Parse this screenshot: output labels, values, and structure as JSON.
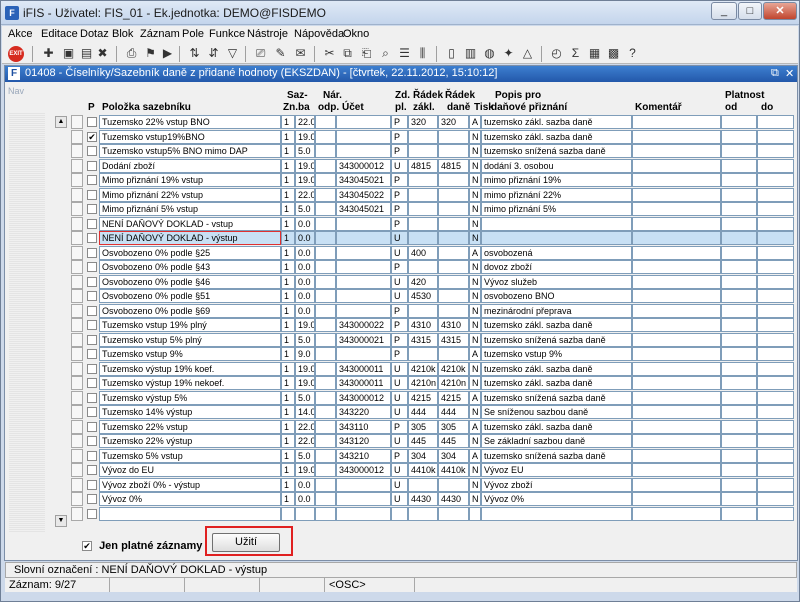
{
  "window": {
    "title": "iFIS - Uživatel: FIS_01 - Ek.jednotka: DEMO@FISDEMO",
    "logo_text": "iFIS"
  },
  "menu": [
    "Akce",
    "Editace",
    "Dotaz",
    "Blok",
    "Záznam",
    "Pole",
    "Funkce",
    "Nástroje",
    "Nápověda",
    "Okno"
  ],
  "toolbar": {
    "exit_label": "EXIT"
  },
  "form": {
    "title": "01408 - Číselníky/Sazebník daně z přidané hodnoty (EKSZDAN) - [čtvrtek, 22.11.2012, 15:10:12]",
    "nav_label": "Nav"
  },
  "columns": {
    "p": "P",
    "name": "Položka sazebníku",
    "zn": [
      "Saz-",
      "Zn.ba"
    ],
    "nar": [
      "Nár.",
      "odp."
    ],
    "ucet": "Účet",
    "zd": [
      "Zd.",
      "pl."
    ],
    "rz": [
      "Řádek",
      "zákl."
    ],
    "rd": [
      "Řádek",
      "daně"
    ],
    "tisk": "Tisk",
    "popis": [
      "Popis pro",
      "daňové přiznání"
    ],
    "komentar": "Komentář",
    "platnost": "Platnost",
    "od": "od",
    "do": "do"
  },
  "rows": [
    {
      "checked": false,
      "name": "Tuzemsko  22% vstup BNO",
      "zn": "1",
      "sazba": "22.0",
      "ucet": "",
      "zd": "P",
      "rz": "320",
      "rd": "320",
      "tisk": "A",
      "popis": "tuzemsko zákl. sazba daně"
    },
    {
      "checked": true,
      "name": "Tuzemsko vstup19%BNO",
      "zn": "1",
      "sazba": "19.0",
      "ucet": "",
      "zd": "P",
      "rz": "",
      "rd": "",
      "tisk": "N",
      "popis": "tuzemsko zákl. sazba daně"
    },
    {
      "checked": false,
      "name": "Tuzemsko vstup5% BNO mimo DAP",
      "zn": "1",
      "sazba": "5.0",
      "ucet": "",
      "zd": "P",
      "rz": "",
      "rd": "",
      "tisk": "N",
      "popis": "tuzemsko snížená sazba daně"
    },
    {
      "checked": false,
      "name": "Dodání zboží",
      "zn": "1",
      "sazba": "19.0",
      "ucet": "343000012",
      "zd": "U",
      "rz": "4815",
      "rd": "4815",
      "tisk": "N",
      "popis": "dodání 3. osobou"
    },
    {
      "checked": false,
      "name": "Mimo přiznání  19% vstup",
      "zn": "1",
      "sazba": "19.0",
      "ucet": "343045021",
      "zd": "P",
      "rz": "",
      "rd": "",
      "tisk": "N",
      "popis": "mimo přiznání 19%"
    },
    {
      "checked": false,
      "name": "Mimo přiznání  22% vstup",
      "zn": "1",
      "sazba": "22.0",
      "ucet": "343045022",
      "zd": "P",
      "rz": "",
      "rd": "",
      "tisk": "N",
      "popis": "mimo přiznání 22%"
    },
    {
      "checked": false,
      "name": "Mimo přiznání  5% vstup",
      "zn": "1",
      "sazba": "5.0",
      "ucet": "343045021",
      "zd": "P",
      "rz": "",
      "rd": "",
      "tisk": "N",
      "popis": "mimo přiznání 5%"
    },
    {
      "checked": false,
      "name": "NENÍ DAŇOVÝ DOKLAD - vstup",
      "zn": "1",
      "sazba": "0.0",
      "ucet": "",
      "zd": "P",
      "rz": "",
      "rd": "",
      "tisk": "N",
      "popis": ""
    },
    {
      "checked": false,
      "name": "NENÍ DAŇOVÝ DOKLAD - výstup",
      "zn": "1",
      "sazba": "0.0",
      "ucet": "",
      "zd": "U",
      "rz": "",
      "rd": "",
      "tisk": "N",
      "popis": "",
      "selected": true
    },
    {
      "checked": false,
      "name": "Osvobozeno 0% podle §25",
      "zn": "1",
      "sazba": "0.0",
      "ucet": "",
      "zd": "U",
      "rz": "400",
      "rd": "",
      "tisk": "A",
      "popis": "osvobozená"
    },
    {
      "checked": false,
      "name": "Osvobozeno 0% podle §43",
      "zn": "1",
      "sazba": "0.0",
      "ucet": "",
      "zd": "P",
      "rz": "",
      "rd": "",
      "tisk": "N",
      "popis": "dovoz zboží"
    },
    {
      "checked": false,
      "name": "Osvobozeno 0% podle §46",
      "zn": "1",
      "sazba": "0.0",
      "ucet": "",
      "zd": "U",
      "rz": "420",
      "rd": "",
      "tisk": "N",
      "popis": "Vývoz služeb"
    },
    {
      "checked": false,
      "name": "Osvobozeno 0% podle §51",
      "zn": "1",
      "sazba": "0.0",
      "ucet": "",
      "zd": "U",
      "rz": "4530",
      "rd": "",
      "tisk": "N",
      "popis": "osvobozeno BNO"
    },
    {
      "checked": false,
      "name": "Osvobozeno 0% podle §69",
      "zn": "1",
      "sazba": "0.0",
      "ucet": "",
      "zd": "P",
      "rz": "",
      "rd": "",
      "tisk": "N",
      "popis": "mezinárodní přeprava"
    },
    {
      "checked": false,
      "name": "Tuzemsko vstup 19% plný",
      "zn": "1",
      "sazba": "19.0",
      "ucet": "343000022",
      "zd": "P",
      "rz": "4310",
      "rd": "4310",
      "tisk": "N",
      "popis": "tuzemsko zákl. sazba daně"
    },
    {
      "checked": false,
      "name": "Tuzemsko vstup 5% plný",
      "zn": "1",
      "sazba": "5.0",
      "ucet": "343000021",
      "zd": "P",
      "rz": "4315",
      "rd": "4315",
      "tisk": "N",
      "popis": "tuzemsko snížená sazba daně"
    },
    {
      "checked": false,
      "name": "Tuzemsko vstup 9%",
      "zn": "1",
      "sazba": "9.0",
      "ucet": "",
      "zd": "P",
      "rz": "",
      "rd": "",
      "tisk": "A",
      "popis": "tuzemsko vstup 9%"
    },
    {
      "checked": false,
      "name": "Tuzemsko výstup 19% koef.",
      "zn": "1",
      "sazba": "19.0",
      "ucet": "343000011",
      "zd": "U",
      "rz": "4210k",
      "rd": "4210k",
      "tisk": "N",
      "popis": "tuzemsko zákl. sazba daně"
    },
    {
      "checked": false,
      "name": "Tuzemsko výstup 19% nekoef.",
      "zn": "1",
      "sazba": "19.0",
      "ucet": "343000011",
      "zd": "U",
      "rz": "4210n",
      "rd": "4210n",
      "tisk": "N",
      "popis": "tuzemsko zákl. sazba daně"
    },
    {
      "checked": false,
      "name": "Tuzemsko výstup 5%",
      "zn": "1",
      "sazba": "5.0",
      "ucet": "343000012",
      "zd": "U",
      "rz": "4215",
      "rd": "4215",
      "tisk": "A",
      "popis": "tuzemsko snížená sazba daně"
    },
    {
      "checked": false,
      "name": "Tuzemsko 14% výstup",
      "zn": "1",
      "sazba": "14.0",
      "ucet": "343220",
      "zd": "U",
      "rz": "444",
      "rd": "444",
      "tisk": "N",
      "popis": "Se sníženou sazbou daně"
    },
    {
      "checked": false,
      "name": "Tuzemsko 22% vstup",
      "zn": "1",
      "sazba": "22.0",
      "ucet": "343110",
      "zd": "P",
      "rz": "305",
      "rd": "305",
      "tisk": "A",
      "popis": "tuzemsko zákl. sazba daně"
    },
    {
      "checked": false,
      "name": "Tuzemsko 22% výstup",
      "zn": "1",
      "sazba": "22.0",
      "ucet": "343120",
      "zd": "U",
      "rz": "445",
      "rd": "445",
      "tisk": "N",
      "popis": "Se základní sazbou daně"
    },
    {
      "checked": false,
      "name": "Tuzemsko 5% vstup",
      "zn": "1",
      "sazba": "5.0",
      "ucet": "343210",
      "zd": "P",
      "rz": "304",
      "rd": "304",
      "tisk": "A",
      "popis": "tuzemsko snížená sazba daně"
    },
    {
      "checked": false,
      "name": "Vývoz do EU",
      "zn": "1",
      "sazba": "19.0",
      "ucet": "343000012",
      "zd": "U",
      "rz": "4410k",
      "rd": "4410k",
      "tisk": "N",
      "popis": "Vývoz EU"
    },
    {
      "checked": false,
      "name": "Vývoz zboží 0% - výstup",
      "zn": "1",
      "sazba": "0.0",
      "ucet": "",
      "zd": "U",
      "rz": "",
      "rd": "",
      "tisk": "N",
      "popis": "   Vývoz zboží"
    },
    {
      "checked": false,
      "name": "Vývoz 0%",
      "zn": "1",
      "sazba": "0.0",
      "ucet": "",
      "zd": "U",
      "rz": "4430",
      "rd": "4430",
      "tisk": "N",
      "popis": "Vývoz 0%"
    },
    {
      "checked": false,
      "name": "",
      "zn": "",
      "sazba": "",
      "ucet": "",
      "zd": "",
      "rz": "",
      "rd": "",
      "tisk": "",
      "popis": ""
    }
  ],
  "footer": {
    "filter_label": "Jen platné záznamy",
    "filter_checked": true,
    "apply_label": "Užití"
  },
  "status": {
    "line1": "Slovní označení : NENÍ DAŇOVÝ DOKLAD - výstup",
    "record": "Záznam: 9/27",
    "osc": "<OSC>"
  }
}
